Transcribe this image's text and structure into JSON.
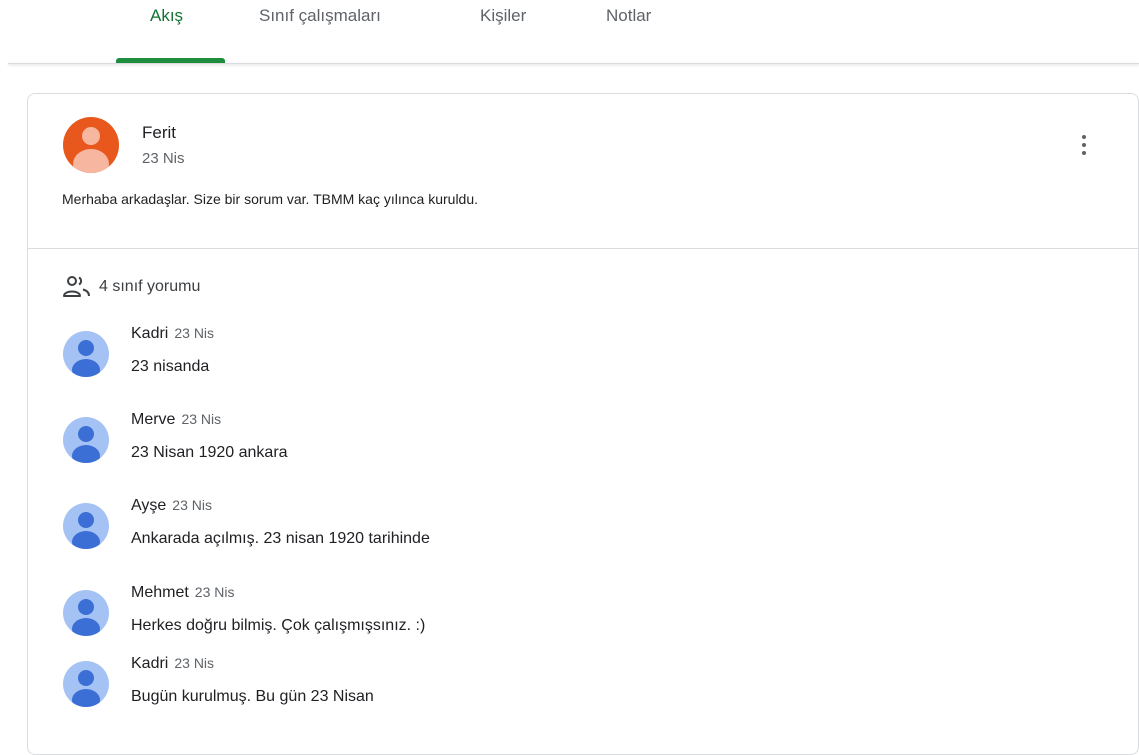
{
  "tabs": [
    {
      "label": "Akış"
    },
    {
      "label": "Sınıf çalışmaları"
    },
    {
      "label": "Kişiler"
    },
    {
      "label": "Notlar"
    }
  ],
  "active_tab": "Akış",
  "post": {
    "author": "Ferit",
    "date": "23 Nis",
    "text": "Merhaba arkadaşlar. Size bir sorum var. TBMM kaç yılınca kuruldu."
  },
  "comments_header": "4 sınıf yorumu",
  "comments": [
    {
      "name": "Kadri",
      "date": "23 Nis",
      "text": "23 nisanda"
    },
    {
      "name": "Merve",
      "date": "23 Nis",
      "text": "23 Nisan 1920 ankara"
    },
    {
      "name": "Ayşe",
      "date": "23 Nis",
      "text": "Ankarada açılmış. 23 nisan 1920 tarihinde"
    },
    {
      "name": "Mehmet",
      "date": "23 Nis",
      "text": "Herkes doğru bilmiş. Çok çalışmışsınız. :)"
    },
    {
      "name": "Kadri",
      "date": "23 Nis",
      "text": "Bugün kurulmuş. Bu gün 23 Nisan"
    }
  ],
  "colors": {
    "accent": "#1e8e3e",
    "post_avatar": "#e8581c",
    "comment_avatar_bg": "#a4c2f4",
    "comment_avatar_fg": "#3b6fd6"
  }
}
